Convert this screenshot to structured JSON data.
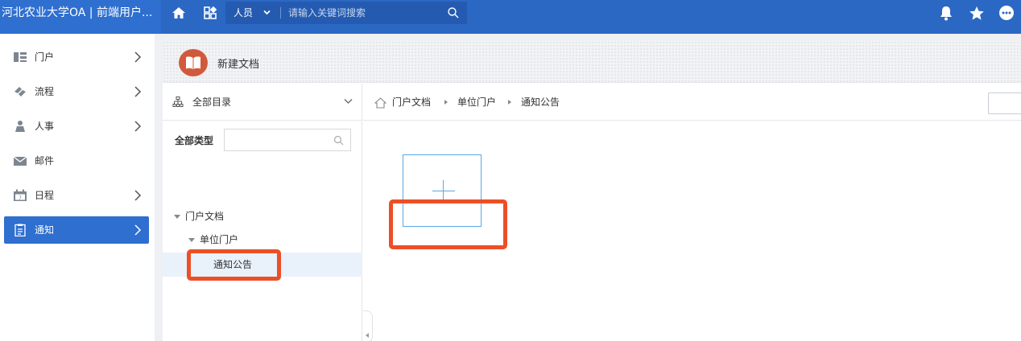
{
  "app": {
    "title": "河北农业大学OA | 前端用户..."
  },
  "topbar": {
    "search": {
      "scope": "人员",
      "placeholder": "请输入关键词搜索"
    }
  },
  "nav": {
    "items": [
      {
        "label": "门户"
      },
      {
        "label": "流程"
      },
      {
        "label": "人事"
      },
      {
        "label": "邮件"
      },
      {
        "label": "日程"
      },
      {
        "label": "通知"
      }
    ],
    "active": "通知"
  },
  "header": {
    "title": "新建文档"
  },
  "tree": {
    "catalog_label": "全部目录",
    "type_label": "全部类型",
    "nodes": [
      {
        "label": "门户文档"
      },
      {
        "label": "单位门户"
      },
      {
        "label": "通知公告"
      }
    ]
  },
  "breadcrumb": {
    "items": [
      {
        "label": "门户文档"
      },
      {
        "label": "单位门户"
      },
      {
        "label": "通知公告"
      }
    ]
  },
  "colors": {
    "brand": "#2b68c4",
    "active_nav": "#2e6fd0",
    "highlight": "#ec4f27",
    "accent": "#5aa7e6",
    "doc_icon": "#d25a3c"
  },
  "icons": [
    "home-icon",
    "apps-icon",
    "search-icon",
    "bell-icon",
    "star-icon",
    "more-icon",
    "portal-icon",
    "flow-icon",
    "person-icon",
    "mail-icon",
    "calendar-icon",
    "notice-icon",
    "book-icon",
    "hierarchy-icon",
    "plus-icon"
  ]
}
